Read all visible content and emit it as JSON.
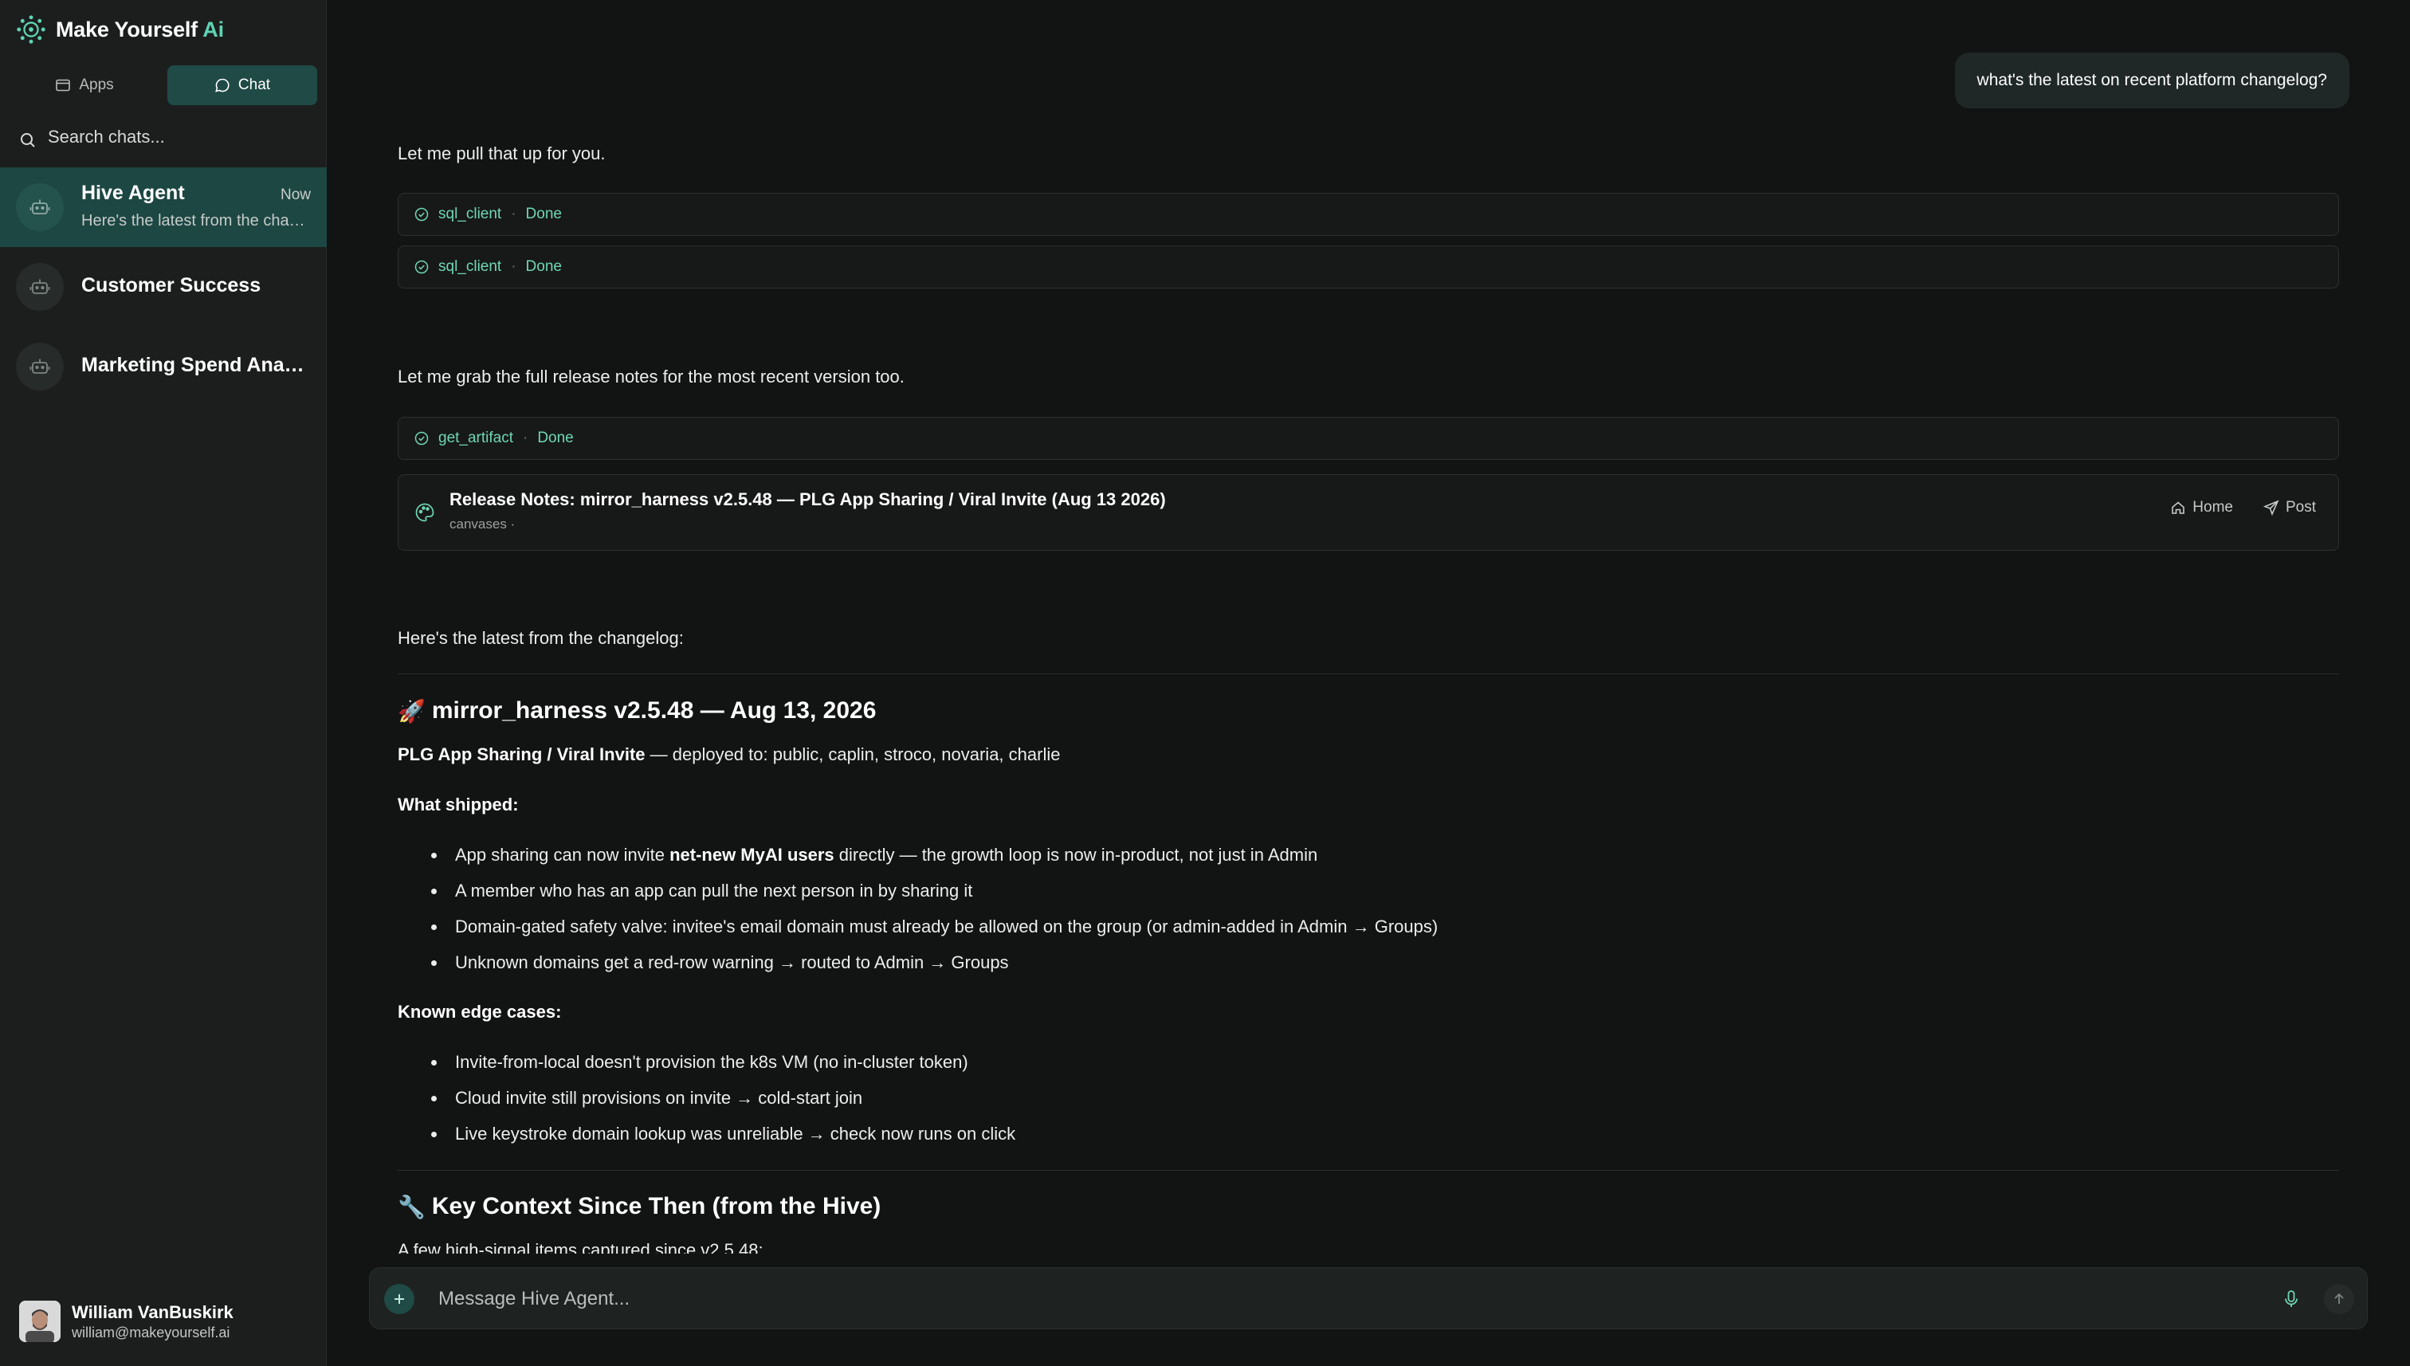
{
  "brand": {
    "name": "Make Yourself",
    "accent": "Ai"
  },
  "colors": {
    "accent": "#5fd3b3",
    "active_bg": "#1f4a46",
    "bg": "#121313",
    "sidebar_bg": "#1c1e1e"
  },
  "sidebar": {
    "tabs": [
      {
        "label": "Apps",
        "icon": "window-icon"
      },
      {
        "label": "Chat",
        "icon": "chat-bubble-icon"
      }
    ],
    "search_placeholder": "Search chats...",
    "chats": [
      {
        "title": "Hive Agent",
        "time": "Now",
        "preview": "Here's the latest from the changelog:"
      },
      {
        "title": "Customer Success"
      },
      {
        "title": "Marketing Spend Analysis"
      }
    ],
    "user": {
      "name": "William VanBuskirk",
      "email": "william@makeyourself.ai"
    }
  },
  "conversation": {
    "user_message": "what's the latest on recent platform changelog?",
    "intro": "Let me pull that up for you.",
    "tool_calls_1": [
      {
        "name": "sql_client",
        "status": "Done"
      },
      {
        "name": "sql_client",
        "status": "Done"
      }
    ],
    "followup": "Let me grab the full release notes for the most recent version too.",
    "tool_calls_2": [
      {
        "name": "get_artifact",
        "status": "Done"
      }
    ],
    "artifact": {
      "title": "Release Notes: mirror_harness v2.5.48 — PLG App Sharing / Viral Invite (Aug 13 2026)",
      "subtitle": "canvases ·",
      "actions": {
        "home": "Home",
        "post": "Post"
      }
    },
    "summary_intro": "Here's the latest from the changelog:",
    "release": {
      "emoji": "🚀",
      "heading": "mirror_harness v2.5.48 — Aug 13, 2026",
      "feature_bold": "PLG App Sharing / Viral Invite",
      "feature_rest": " — deployed to: public, caplin, stroco, novaria, charlie",
      "shipped_label": "What shipped:",
      "shipped": [
        {
          "pre": "App sharing can now invite ",
          "bold": "net-new MyAI users",
          "post": " directly — the growth loop is now in-product, not just in Admin"
        },
        {
          "pre": "A member who has an app can pull the next person in by sharing it"
        },
        {
          "pre": "Domain-gated safety valve: invitee's email domain must already be allowed on the group (or admin-added in Admin → Groups)"
        },
        {
          "pre": "Unknown domains get a red-row warning → routed to Admin → Groups"
        }
      ],
      "edge_label": "Known edge cases:",
      "edge_cases": [
        "Invite-from-local doesn't provision the k8s VM (no in-cluster token)",
        "Cloud invite still provisions on invite → cold-start join",
        "Live keystroke domain lookup was unreliable → check now runs on click"
      ]
    },
    "context": {
      "emoji": "🔧",
      "heading": "Key Context Since Then (from the Hive)",
      "intro": "A few high-signal items captured since v2.5.48:"
    }
  },
  "composer": {
    "placeholder": "Message Hive Agent..."
  }
}
